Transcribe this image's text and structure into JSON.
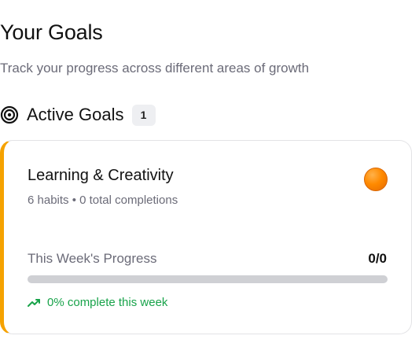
{
  "header": {
    "title": "Your Goals",
    "subtitle": "Track your progress across different areas of growth"
  },
  "section": {
    "icon": "target-icon",
    "title": "Active Goals",
    "count": "1"
  },
  "goals": [
    {
      "title": "Learning & Creativity",
      "meta": "6 habits • 0 total completions",
      "color": "#ff8a00",
      "accent": "#f5a200",
      "progress_label": "This Week's Progress",
      "progress_value": "0/0",
      "progress_fraction": 0,
      "trend_icon": "trending-up-icon",
      "trend_text": "0% complete this week"
    }
  ]
}
